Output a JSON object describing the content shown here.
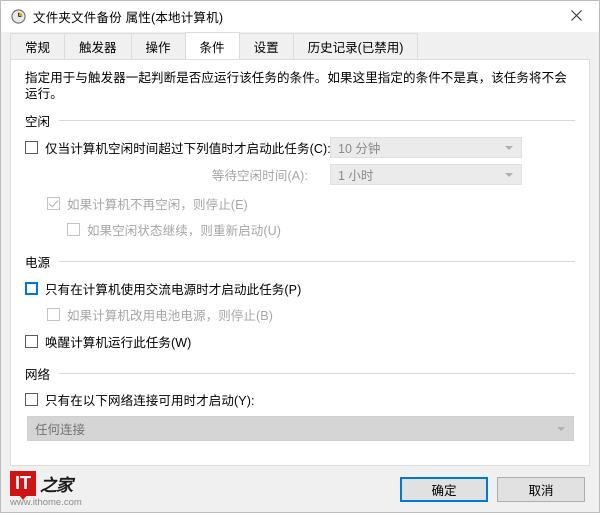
{
  "window": {
    "title": "文件夹文件备份 属性(本地计算机)",
    "icon": "clock-icon",
    "close_label": "✕"
  },
  "tabs": [
    {
      "label": "常规",
      "active": false
    },
    {
      "label": "触发器",
      "active": false
    },
    {
      "label": "操作",
      "active": false
    },
    {
      "label": "条件",
      "active": true
    },
    {
      "label": "设置",
      "active": false
    },
    {
      "label": "历史记录(已禁用)",
      "active": false
    }
  ],
  "content": {
    "description": "指定用于与触发器一起判断是否应运行该任务的条件。如果这里指定的条件不是真，该任务将不会运行。",
    "idle": {
      "group_label": "空闲",
      "start_only_if_idle": {
        "label": "仅当计算机空闲时间超过下列值时才启动此任务(C):",
        "checked": false,
        "disabled": false
      },
      "idle_duration_value": "10 分钟",
      "wait_for_idle_label": "等待空闲时间(A):",
      "wait_for_idle_value": "1 小时",
      "stop_if_no_longer_idle": {
        "label": "如果计算机不再空闲，则停止(E)",
        "checked": true,
        "disabled": true
      },
      "restart_if_idle_resumes": {
        "label": "如果空闲状态继续，则重新启动(U)",
        "checked": false,
        "disabled": true
      }
    },
    "power": {
      "group_label": "电源",
      "ac_power_only": {
        "label": "只有在计算机使用交流电源时才启动此任务(P)",
        "checked": false,
        "disabled": false,
        "focused": true
      },
      "stop_on_battery": {
        "label": "如果计算机改用电池电源，则停止(B)",
        "checked": false,
        "disabled": true
      },
      "wake_to_run": {
        "label": "唤醒计算机运行此任务(W)",
        "checked": false,
        "disabled": false
      }
    },
    "network": {
      "group_label": "网络",
      "start_only_if_network": {
        "label": "只有在以下网络连接可用时才启动(Y):",
        "checked": false,
        "disabled": false
      },
      "connection_value": "任何连接"
    }
  },
  "footer": {
    "ok_label": "确定",
    "cancel_label": "取消"
  },
  "watermark": {
    "logo_text": "IT",
    "logo_cn": "之家",
    "url": "www.ithome.com"
  },
  "colors": {
    "accent": "#0078d7",
    "window_bg": "#f0f0f0",
    "panel_bg": "#ffffff",
    "disabled_text": "#a6a6a6",
    "brand_red": "#d01414"
  }
}
